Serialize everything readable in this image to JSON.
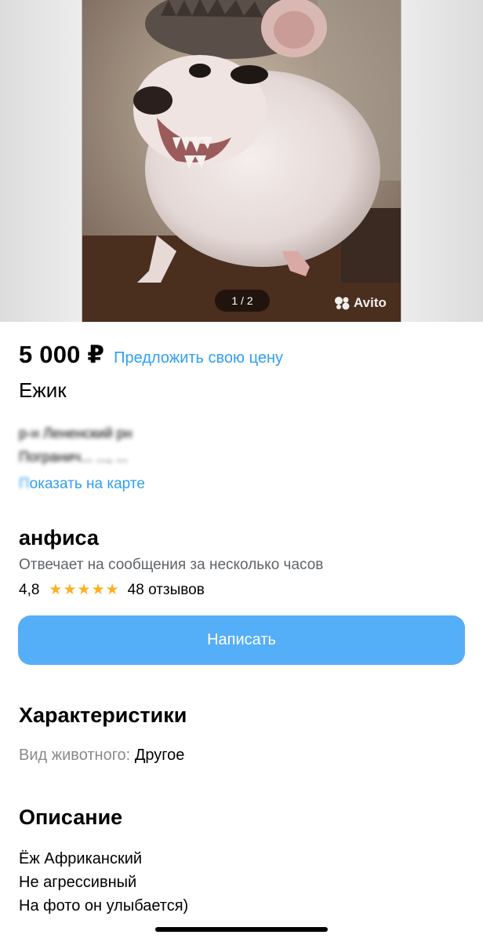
{
  "gallery": {
    "counter": "1 / 2",
    "watermark": "Avito"
  },
  "listing": {
    "price": "5 000 ₽",
    "offer_link": "Предложить свою цену",
    "title": "Ежик",
    "address_line1": "р-н Лененский рн",
    "address_line2": "Погранич... ..., ...",
    "map_link_prefix": "П",
    "map_link_rest": "оказать на карте"
  },
  "seller": {
    "name": "анфиса",
    "response_time": "Отвечает на сообщения за несколько часов",
    "rating": "4,8",
    "rating_stars": 5,
    "reviews": "48 отзывов",
    "write_button": "Написать"
  },
  "characteristics": {
    "title": "Характеристики",
    "items": [
      {
        "label": "Вид животного:",
        "value": "Другое"
      }
    ]
  },
  "description": {
    "title": "Описание",
    "lines": [
      "Ёж Африканский",
      "Не агрессивный",
      "На фото он улыбается)"
    ]
  },
  "colors": {
    "link": "#2f9ff5",
    "button": "#55aef8",
    "star": "#ffb021",
    "secondary_text": "#5f6368"
  }
}
